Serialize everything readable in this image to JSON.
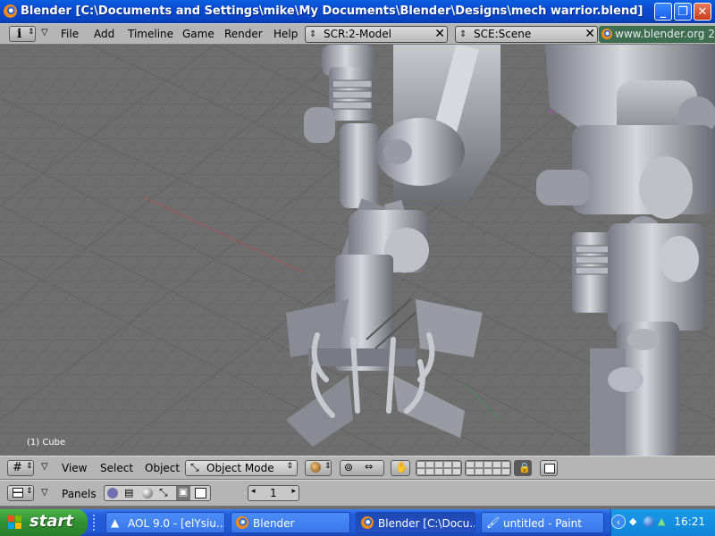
{
  "window": {
    "title": "Blender [C:\\Documents and Settings\\mike\\My Documents\\Blender\\Designs\\mech warrior.blend]",
    "minimize": "_",
    "restore": "❐",
    "close": "✕"
  },
  "top_menu": {
    "items": [
      "File",
      "Add",
      "Timeline",
      "Game",
      "Render",
      "Help"
    ],
    "screen_field": "SCR:2-Model",
    "scene_field": "SCE:Scene",
    "url": "www.blender.org 2"
  },
  "viewport": {
    "object_label": "(1) Cube"
  },
  "view_header": {
    "menus": [
      "View",
      "Select",
      "Object"
    ],
    "mode": "Object Mode"
  },
  "panel_header": {
    "label": "Panels",
    "frame": "1"
  },
  "taskbar": {
    "start": "start",
    "tasks": [
      "AOL 9.0 - [elYsiu...",
      "Blender",
      "Blender [C:\\Docu...",
      "untitled - Paint"
    ],
    "clock": "16:21"
  },
  "colors": {
    "title_bar": "#0a4ad0",
    "header_gray": "#b5b5b5",
    "viewport_gray": "#6e6e6e",
    "taskbar_blue": "#245ddb",
    "start_green": "#2f8f2f",
    "url_green": "#3e6e52"
  }
}
